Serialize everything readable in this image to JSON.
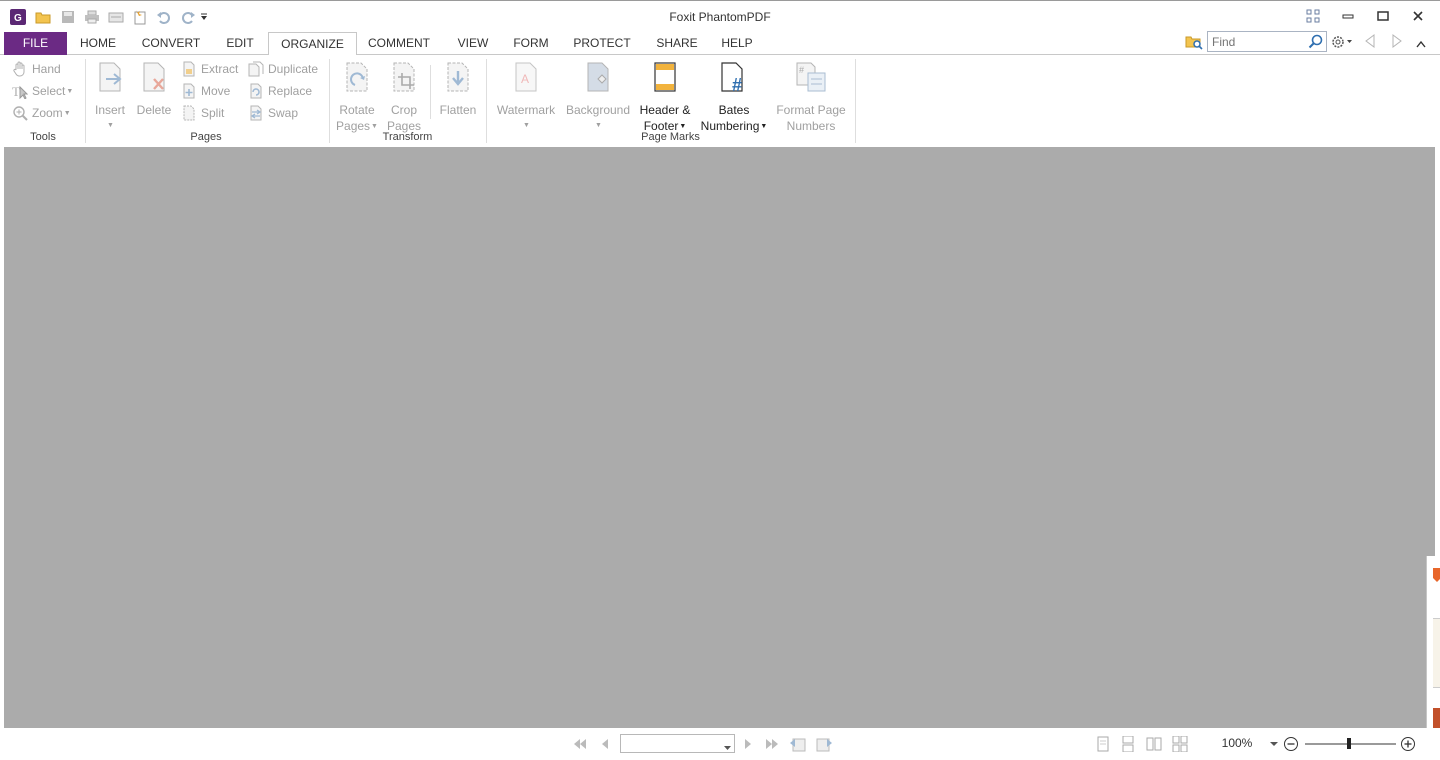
{
  "window": {
    "title": "Foxit PhantomPDF"
  },
  "quick_access": [
    "app-logo-icon",
    "open-folder-icon",
    "save-icon",
    "print-icon",
    "scan-icon",
    "new-icon",
    "undo-icon",
    "redo-icon",
    "customize-dropdown-icon"
  ],
  "tabs": [
    {
      "label": "FILE",
      "active": false
    },
    {
      "label": "HOME",
      "active": false
    },
    {
      "label": "CONVERT",
      "active": false
    },
    {
      "label": "EDIT",
      "active": false
    },
    {
      "label": "ORGANIZE",
      "active": true
    },
    {
      "label": "COMMENT",
      "active": false
    },
    {
      "label": "VIEW",
      "active": false
    },
    {
      "label": "FORM",
      "active": false
    },
    {
      "label": "PROTECT",
      "active": false
    },
    {
      "label": "SHARE",
      "active": false
    },
    {
      "label": "HELP",
      "active": false
    }
  ],
  "find": {
    "placeholder": "Find"
  },
  "ribbon": {
    "tools": {
      "label": "Tools",
      "hand": "Hand",
      "select": "Select",
      "zoom": "Zoom"
    },
    "pages": {
      "label": "Pages",
      "insert": "Insert",
      "delete": "Delete",
      "extract": "Extract",
      "move": "Move",
      "split": "Split",
      "duplicate": "Duplicate",
      "replace": "Replace",
      "swap": "Swap"
    },
    "transform": {
      "label": "Transform",
      "rotate_line1": "Rotate",
      "rotate_line2": "Pages",
      "crop_line1": "Crop",
      "crop_line2": "Pages",
      "flatten": "Flatten"
    },
    "page_marks": {
      "label": "Page Marks",
      "watermark": "Watermark",
      "background": "Background",
      "header_line1": "Header &",
      "header_line2": "Footer",
      "bates_line1": "Bates",
      "bates_line2": "Numbering",
      "format_line1": "Format Page",
      "format_line2": "Numbers"
    }
  },
  "status": {
    "zoom": "100%"
  },
  "colors": {
    "file_tab": "#6b2a84",
    "doc_background": "#ababab",
    "accent_blue": "#2f6fb0"
  }
}
